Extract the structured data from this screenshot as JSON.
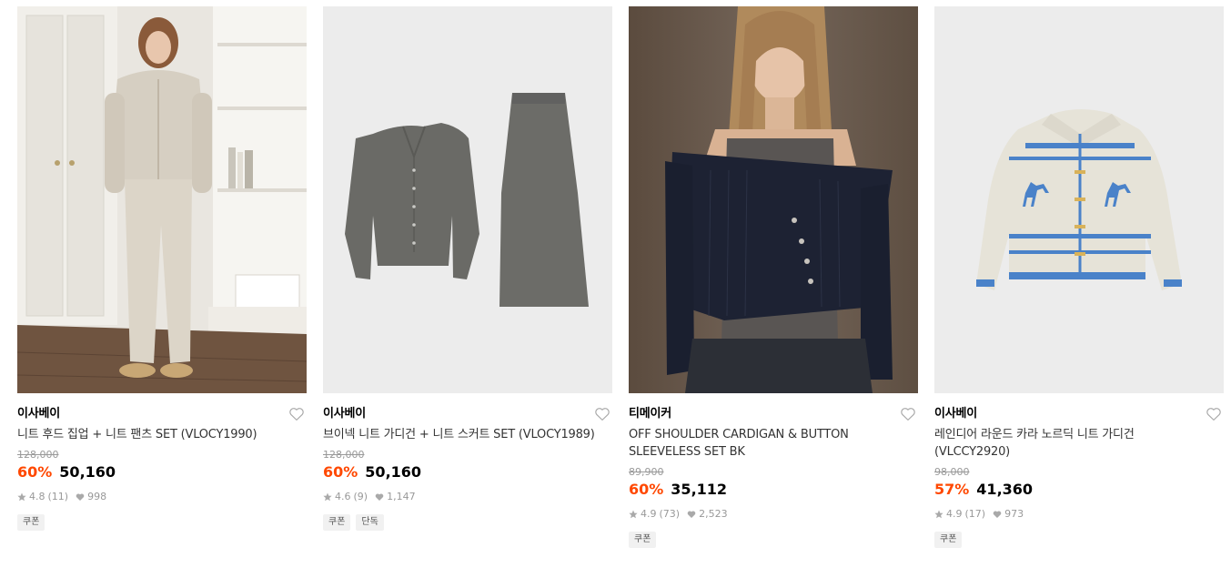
{
  "products": [
    {
      "brand": "이사베이",
      "name": "니트 후드 집업 + 니트 팬츠 SET (VLOCY1990)",
      "original_price": "128,000",
      "discount": "60%",
      "price": "50,160",
      "rating": "4.8",
      "reviews": "(11)",
      "likes": "998",
      "tags": [
        "쿠폰"
      ]
    },
    {
      "brand": "이사베이",
      "name": "브이넥 니트 가디건 + 니트 스커트 SET (VLOCY1989)",
      "original_price": "128,000",
      "discount": "60%",
      "price": "50,160",
      "rating": "4.6",
      "reviews": "(9)",
      "likes": "1,147",
      "tags": [
        "쿠폰",
        "단독"
      ]
    },
    {
      "brand": "티메이커",
      "name": "OFF SHOULDER CARDIGAN & BUTTON SLEEVELESS SET BK",
      "original_price": "89,900",
      "discount": "60%",
      "price": "35,112",
      "rating": "4.9",
      "reviews": "(73)",
      "likes": "2,523",
      "tags": [
        "쿠폰"
      ]
    },
    {
      "brand": "이사베이",
      "name": "레인디어 라운드 카라 노르딕 니트 가디건 (VLCCY2920)",
      "original_price": "98,000",
      "discount": "57%",
      "price": "41,360",
      "rating": "4.9",
      "reviews": "(17)",
      "likes": "973",
      "tags": [
        "쿠폰"
      ]
    }
  ],
  "icons": {
    "heart": "heart-outline-icon",
    "star": "star-icon",
    "like": "heart-filled-icon"
  },
  "colors": {
    "discount": "#ff4800",
    "muted": "#999999",
    "tag_bg": "#f1f1f1"
  }
}
